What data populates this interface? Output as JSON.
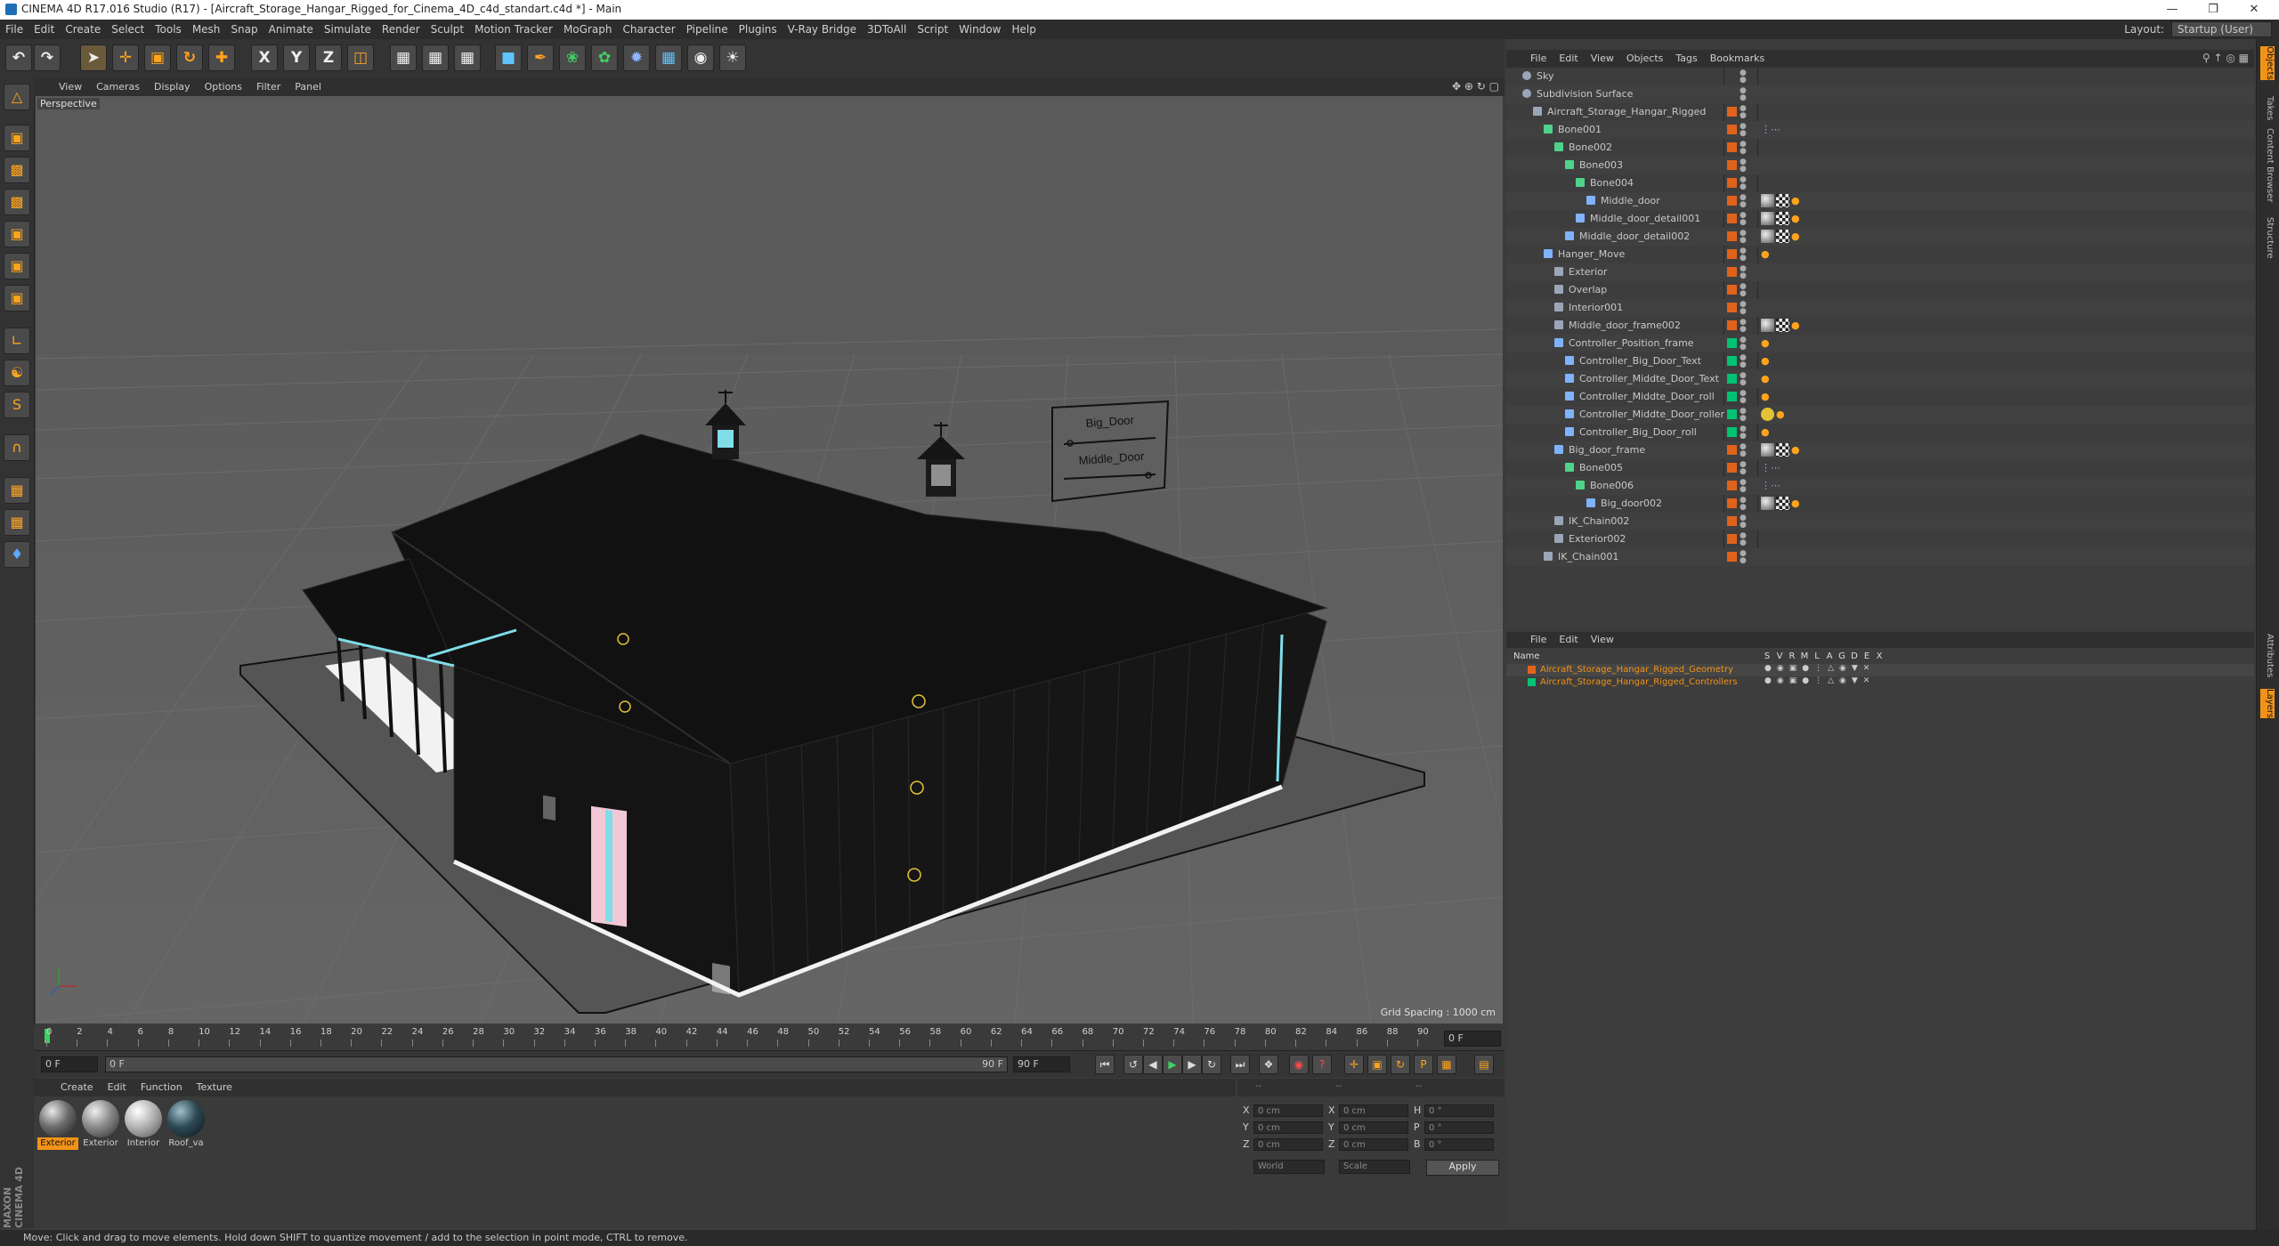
{
  "window": {
    "title": "CINEMA 4D R17.016 Studio (R17) - [Aircraft_Storage_Hangar_Rigged_for_Cinema_4D_c4d_standart.c4d *] - Main"
  },
  "menubar": {
    "items": [
      "File",
      "Edit",
      "Create",
      "Select",
      "Tools",
      "Mesh",
      "Snap",
      "Animate",
      "Simulate",
      "Render",
      "Sculpt",
      "Motion Tracker",
      "MoGraph",
      "Character",
      "Pipeline",
      "Plugins",
      "V-Ray Bridge",
      "3DToAll",
      "Script",
      "Window",
      "Help"
    ],
    "layout_label": "Layout:",
    "layout_value": "Startup (User)"
  },
  "toolbar": {
    "axis_x": "X",
    "axis_y": "Y",
    "axis_z": "Z"
  },
  "viewport": {
    "menu": [
      "View",
      "Cameras",
      "Display",
      "Options",
      "Filter",
      "Panel"
    ],
    "label": "Perspective",
    "grid_spacing": "Grid Spacing : 1000 cm",
    "sign_line1": "Big_Door",
    "sign_line2": "Middle_Door"
  },
  "timeline": {
    "ticks": [
      "0",
      "2",
      "4",
      "6",
      "8",
      "10",
      "12",
      "14",
      "16",
      "18",
      "20",
      "22",
      "24",
      "26",
      "28",
      "30",
      "32",
      "34",
      "36",
      "38",
      "40",
      "42",
      "44",
      "46",
      "48",
      "50",
      "52",
      "54",
      "56",
      "58",
      "60",
      "62",
      "64",
      "66",
      "68",
      "70",
      "72",
      "74",
      "76",
      "78",
      "80",
      "82",
      "84",
      "86",
      "88",
      "90"
    ],
    "current_frame": "0 F",
    "start": "0 F",
    "min_field": "0 F",
    "max_field": "90 F",
    "end": "90 F"
  },
  "materials": {
    "menu": [
      "Create",
      "Edit",
      "Function",
      "Texture"
    ],
    "items": [
      {
        "label": "Exterior",
        "selected": true,
        "color": "#6b6b6b"
      },
      {
        "label": "Exterior",
        "selected": false,
        "color": "#8a8a8a"
      },
      {
        "label": "Interior",
        "selected": false,
        "color": "#b4b4b4"
      },
      {
        "label": "Roof_va",
        "selected": false,
        "color": "#2d4a55"
      }
    ]
  },
  "coordinates": {
    "head": [
      "--",
      "--",
      "--"
    ],
    "rows": [
      {
        "a": "X",
        "av": "0 cm",
        "b": "X",
        "bv": "0 cm",
        "c": "H",
        "cv": "0 °"
      },
      {
        "a": "Y",
        "av": "0 cm",
        "b": "Y",
        "bv": "0 cm",
        "c": "P",
        "cv": "0 °"
      },
      {
        "a": "Z",
        "av": "0 cm",
        "b": "Z",
        "bv": "0 cm",
        "c": "B",
        "cv": "0 °"
      }
    ],
    "mode1": "World",
    "mode2": "Scale",
    "apply": "Apply"
  },
  "objects": {
    "menu": [
      "File",
      "Edit",
      "View",
      "Objects",
      "Tags",
      "Bookmarks"
    ],
    "rows": [
      {
        "name": "Sky",
        "indent": 0,
        "tag": "none",
        "tags": ""
      },
      {
        "name": "Subdivision Surface",
        "indent": 0,
        "tag": "none",
        "tags": ""
      },
      {
        "name": "Aircraft_Storage_Hangar_Rigged",
        "indent": 1,
        "tag": "orange",
        "tags": ""
      },
      {
        "name": "Bone001",
        "indent": 2,
        "tag": "orange",
        "tags": "ik"
      },
      {
        "name": "Bone002",
        "indent": 3,
        "tag": "orange",
        "tags": ""
      },
      {
        "name": "Bone003",
        "indent": 4,
        "tag": "orange",
        "tags": ""
      },
      {
        "name": "Bone004",
        "indent": 5,
        "tag": "orange",
        "tags": ""
      },
      {
        "name": "Middle_door",
        "indent": 6,
        "tag": "orange",
        "tags": "mat"
      },
      {
        "name": "Middle_door_detail001",
        "indent": 5,
        "tag": "orange",
        "tags": "mat"
      },
      {
        "name": "Middle_door_detail002",
        "indent": 4,
        "tag": "orange",
        "tags": "mat"
      },
      {
        "name": "Hanger_Move",
        "indent": 2,
        "tag": "orange",
        "tags": "dot"
      },
      {
        "name": "Exterior",
        "indent": 3,
        "tag": "orange",
        "tags": ""
      },
      {
        "name": "Overlap",
        "indent": 3,
        "tag": "orange",
        "tags": ""
      },
      {
        "name": "Interior001",
        "indent": 3,
        "tag": "orange",
        "tags": ""
      },
      {
        "name": "Middle_door_frame002",
        "indent": 3,
        "tag": "orange",
        "tags": "mat"
      },
      {
        "name": "Controller_Position_frame",
        "indent": 3,
        "tag": "green",
        "tags": "dot"
      },
      {
        "name": "Controller_Big_Door_Text",
        "indent": 4,
        "tag": "green",
        "tags": "dot"
      },
      {
        "name": "Controller_Middte_Door_Text",
        "indent": 4,
        "tag": "green",
        "tags": "dot"
      },
      {
        "name": "Controller_Middte_Door_roll",
        "indent": 4,
        "tag": "green",
        "tags": "dot"
      },
      {
        "name": "Controller_Middte_Door_roller",
        "indent": 4,
        "tag": "green",
        "tags": "ctrl"
      },
      {
        "name": "Controller_Big_Door_roll",
        "indent": 4,
        "tag": "green",
        "tags": "dot"
      },
      {
        "name": "Big_door_frame",
        "indent": 3,
        "tag": "orange",
        "tags": "mat"
      },
      {
        "name": "Bone005",
        "indent": 4,
        "tag": "orange",
        "tags": "ik"
      },
      {
        "name": "Bone006",
        "indent": 5,
        "tag": "orange",
        "tags": "ik"
      },
      {
        "name": "Big_door002",
        "indent": 6,
        "tag": "orange",
        "tags": "mat"
      },
      {
        "name": "IK_Chain002",
        "indent": 3,
        "tag": "orange",
        "tags": ""
      },
      {
        "name": "Exterior002",
        "indent": 3,
        "tag": "orange",
        "tags": ""
      },
      {
        "name": "IK_Chain001",
        "indent": 2,
        "tag": "orange",
        "tags": ""
      }
    ]
  },
  "layers": {
    "menu": [
      "File",
      "Edit",
      "View"
    ],
    "header_name": "Name",
    "header_cols": [
      "S",
      "V",
      "R",
      "M",
      "L",
      "A",
      "G",
      "D",
      "E",
      "X"
    ],
    "rows": [
      {
        "name": "Aircraft_Storage_Hangar_Rigged_Geometry",
        "color": "#e0631c"
      },
      {
        "name": "Aircraft_Storage_Hangar_Rigged_Controllers",
        "color": "#00c373"
      }
    ]
  },
  "right_tabs": [
    "Objects",
    "Takes",
    "Content Browser",
    "Structure",
    "Attributes",
    "Layers"
  ],
  "status": {
    "text": "Move: Click and drag to move elements. Hold down SHIFT to quantize movement / add to the selection in point mode, CTRL to remove."
  },
  "colors": {
    "accent": "#f29319",
    "tag_orange": "#e0631c",
    "tag_green": "#00c373",
    "viewport_bg": "#5a5a5a"
  }
}
